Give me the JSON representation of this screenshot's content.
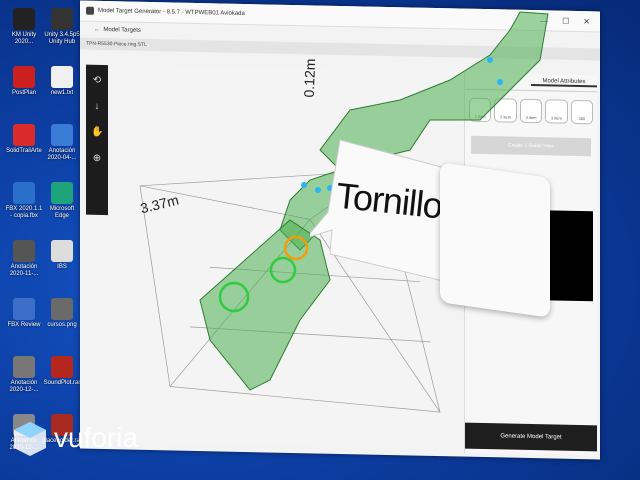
{
  "desktop": {
    "icons": [
      {
        "label": "KM Unity 2020...",
        "color": "#222222"
      },
      {
        "label": "Unity 3.4.5p5 Unity Hub",
        "color": "#333333"
      },
      {
        "label": "PostPlan",
        "color": "#cc1f1f"
      },
      {
        "label": "new1.txt",
        "color": "#f0f0f0"
      },
      {
        "label": "SolidTrailArte",
        "color": "#d92b2b"
      },
      {
        "label": "Anotación 2020-04-...",
        "color": "#3a7bd5"
      },
      {
        "label": "FBX 2020.1.1 - copia.fbx",
        "color": "#2a6fc9"
      },
      {
        "label": "Microsoft Edge",
        "color": "#1fa37a"
      },
      {
        "label": "Anotación 2020-11-...",
        "color": "#555555"
      },
      {
        "label": "IBS",
        "color": "#dddddd"
      },
      {
        "label": "FBX Review",
        "color": "#3d6ec7"
      },
      {
        "label": "cursos.png",
        "color": "#6a6a6a"
      },
      {
        "label": "Anotación 2020-12-...",
        "color": "#777777"
      },
      {
        "label": "SoundPlot.rar",
        "color": "#b5271d"
      },
      {
        "label": "Anotación 2020-12-...",
        "color": "#888888"
      },
      {
        "label": "placeholder.rar",
        "color": "#a62a20"
      }
    ]
  },
  "window": {
    "title": "Model Target Generator - 8.5.7 - WTPWEB01 Aviokada",
    "back_label": "Model Targets",
    "path": "TPN-R5530-Piece.ring.STL",
    "controls": [
      "—",
      "☐",
      "✕"
    ]
  },
  "toolbar": {
    "tools": [
      "⟲",
      "↓",
      "✋",
      "⊕"
    ]
  },
  "viewport": {
    "dim_vertical": "0.12m",
    "dim_diagonal": "3.37m"
  },
  "panel": {
    "tabs": [
      "",
      "Model Attributes"
    ],
    "thumbs": [
      "1 item",
      "2 item",
      "4 item",
      "3 item",
      "360"
    ],
    "create_label": "Create 1 Guide View",
    "generate_label": "Generate Model Target"
  },
  "overlay": {
    "bubble_text": "Tornillo",
    "brand": "vuforia",
    "brand_color": "#ffffff",
    "model_color": "#4caf50"
  }
}
